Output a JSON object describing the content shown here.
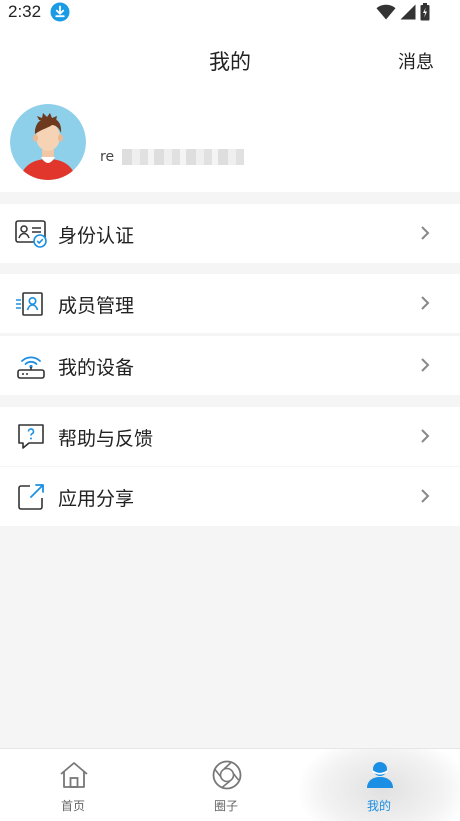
{
  "status_bar": {
    "time": "2:32"
  },
  "header": {
    "title": "我的",
    "message_label": "消息"
  },
  "profile": {
    "username_prefix": "re"
  },
  "menu": {
    "items": [
      {
        "label": "身份认证",
        "icon": "id-card-icon"
      },
      {
        "label": "成员管理",
        "icon": "member-card-icon"
      },
      {
        "label": "我的设备",
        "icon": "router-icon"
      },
      {
        "label": "帮助与反馈",
        "icon": "help-chat-icon"
      },
      {
        "label": "应用分享",
        "icon": "share-icon"
      }
    ]
  },
  "tabbar": {
    "tabs": [
      {
        "label": "首页",
        "icon": "home-icon"
      },
      {
        "label": "圈子",
        "icon": "aperture-icon"
      },
      {
        "label": "我的",
        "icon": "user-icon",
        "active": true
      }
    ]
  },
  "colors": {
    "accent": "#1a8fe3",
    "background": "#f5f5f5",
    "text": "#222222"
  }
}
